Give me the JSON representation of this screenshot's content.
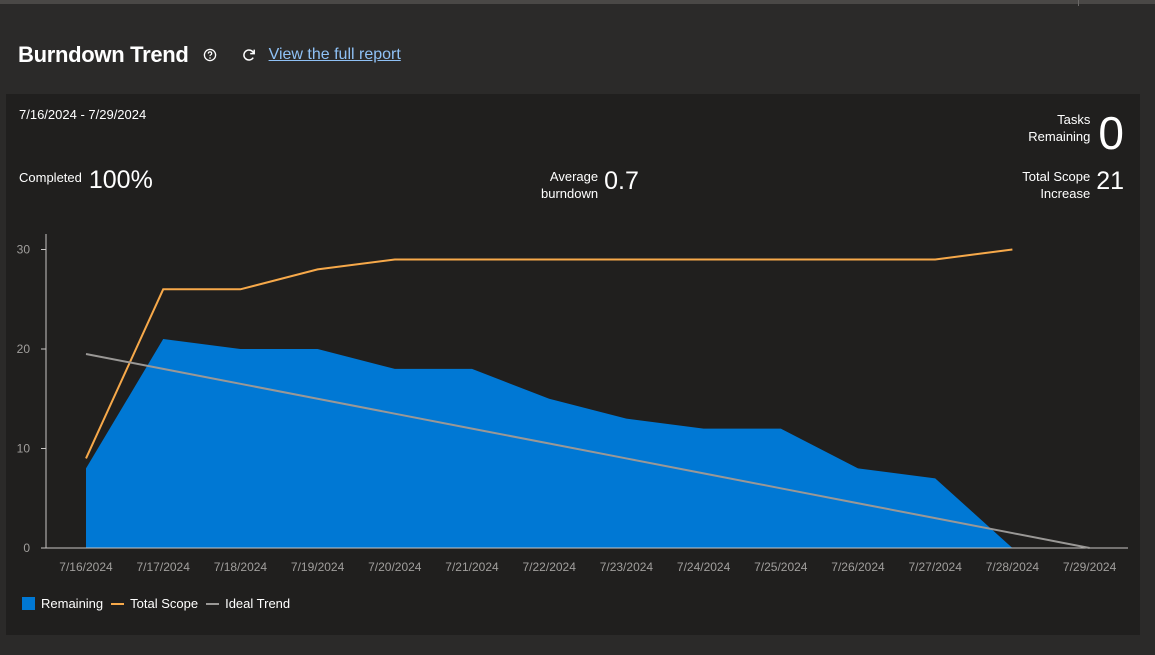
{
  "header": {
    "title": "Burndown Trend",
    "report_link": "View the full report"
  },
  "summary": {
    "date_range": "7/16/2024 - 7/29/2024",
    "completed_label": "Completed",
    "completed_value": "100%",
    "avg_label_1": "Average",
    "avg_label_2": "burndown",
    "avg_value": "0.7",
    "tasks_label_1": "Tasks",
    "tasks_label_2": "Remaining",
    "tasks_value": "0",
    "scope_label_1": "Total Scope",
    "scope_label_2": "Increase",
    "scope_value": "21"
  },
  "colors": {
    "remaining": "#0078d4",
    "total_scope": "#f7a94a",
    "ideal_trend": "#9a9896"
  },
  "chart_data": {
    "type": "area",
    "title": "",
    "xlabel": "",
    "ylabel": "",
    "categories": [
      "7/16/2024",
      "7/17/2024",
      "7/18/2024",
      "7/19/2024",
      "7/20/2024",
      "7/21/2024",
      "7/22/2024",
      "7/23/2024",
      "7/24/2024",
      "7/25/2024",
      "7/26/2024",
      "7/27/2024",
      "7/28/2024",
      "7/29/2024"
    ],
    "ylim": [
      0,
      31.5
    ],
    "yticks": [
      0,
      10,
      20,
      30
    ],
    "grid": false,
    "legend_position": "bottom-left",
    "series": [
      {
        "name": "Remaining",
        "kind": "area",
        "values": [
          8,
          21,
          20,
          20,
          18,
          18,
          15,
          13,
          12,
          12,
          8,
          7,
          0,
          null
        ]
      },
      {
        "name": "Total Scope",
        "kind": "line",
        "values": [
          9,
          26,
          26,
          28,
          29,
          29,
          29,
          29,
          29,
          29,
          29,
          29,
          30,
          null
        ]
      },
      {
        "name": "Ideal Trend",
        "kind": "line",
        "values": [
          19.5,
          18,
          16.5,
          15,
          13.5,
          12,
          10.5,
          9,
          7.5,
          6,
          4.5,
          3,
          1.5,
          0
        ]
      }
    ]
  }
}
